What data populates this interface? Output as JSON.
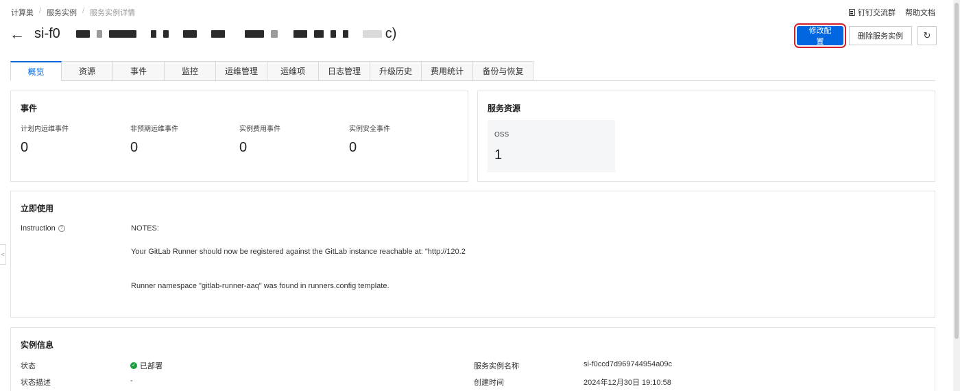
{
  "breadcrumb": {
    "items": [
      "计算巢",
      "服务实例",
      "服务实例详情"
    ],
    "sep": "/"
  },
  "top_links": {
    "dingtalk": "钉钉交流群",
    "help": "帮助文档"
  },
  "header": {
    "back_icon": "←",
    "title_prefix": "si-f0",
    "title_suffix": "c)"
  },
  "actions": {
    "modify": "修改配置",
    "delete": "删除服务实例",
    "refresh_icon": "↻"
  },
  "tabs": [
    "概览",
    "资源",
    "事件",
    "监控",
    "运维管理",
    "运维项",
    "日志管理",
    "升级历史",
    "费用统计",
    "备份与恢复"
  ],
  "events_card": {
    "title": "事件",
    "items": [
      {
        "label": "计划内运维事件",
        "value": "0"
      },
      {
        "label": "非预期运维事件",
        "value": "0"
      },
      {
        "label": "实例费用事件",
        "value": "0"
      },
      {
        "label": "实例安全事件",
        "value": "0"
      }
    ]
  },
  "resources_card": {
    "title": "服务资源",
    "oss_label": "OSS",
    "oss_value": "1"
  },
  "use_now_card": {
    "title": "立即使用",
    "instruction_label": "Instruction",
    "help_icon": "?",
    "notes": [
      "NOTES:",
      "Your GitLab Runner should now be registered against the GitLab instance reachable at: \"http://120.2",
      "Runner namespace \"gitlab-runner-aaq\" was found in runners.config template."
    ]
  },
  "instance_card": {
    "title": "实例信息",
    "status_label": "状态",
    "status_value": "已部署",
    "status_desc_label": "状态描述",
    "status_desc_value": "-",
    "name_label": "服务实例名称",
    "name_value": "si-f0ccd7d969744954a09c",
    "created_label": "创建时间",
    "created_value": "2024年12月30日 19:10:58"
  },
  "side_toggle": "<"
}
